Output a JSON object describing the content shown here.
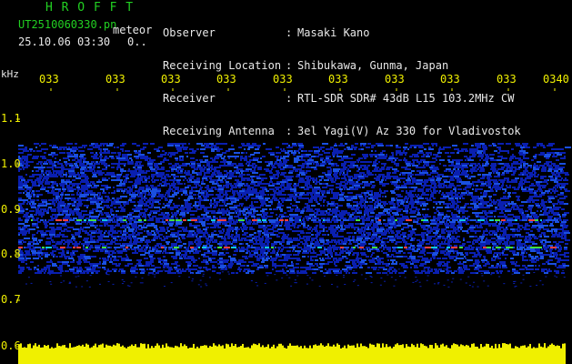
{
  "header": {
    "logo": "H R O F F T",
    "filename": "UT2510060330.pn",
    "filename_suffix": "meteor",
    "datetime": "25.10.06 03:30",
    "counter": "0.."
  },
  "station": {
    "labels": [
      "Observer",
      "Receiving Location",
      "Receiver",
      "Receiving Antenna"
    ],
    "separator": ":",
    "values": [
      "Masaki Kano",
      "Shibukawa, Gunma, Japan",
      "RTL-SDR SDR# 43dB L15 103.2MHz CW",
      "3el Yagi(V) Az 330 for Vladivostok"
    ]
  },
  "axis": {
    "unit": "kHz",
    "freq_ticks": [
      "1.1",
      "1.0",
      "0.9",
      "0.8",
      "0.7",
      "0.6"
    ],
    "time_ticks": [
      "033",
      "033",
      "033",
      "033",
      "033",
      "033",
      "033",
      "033",
      "033",
      "0340"
    ]
  },
  "colors": {
    "background": "#000000",
    "label_green": "#22d022",
    "text_white": "#e8e8e8",
    "tick_yellow": "#f0f000",
    "noise_band": "#f0f000",
    "signal_low": "#0a1fb0",
    "signal_mid": "#10c8e0",
    "signal_high": "#ff4040"
  }
}
